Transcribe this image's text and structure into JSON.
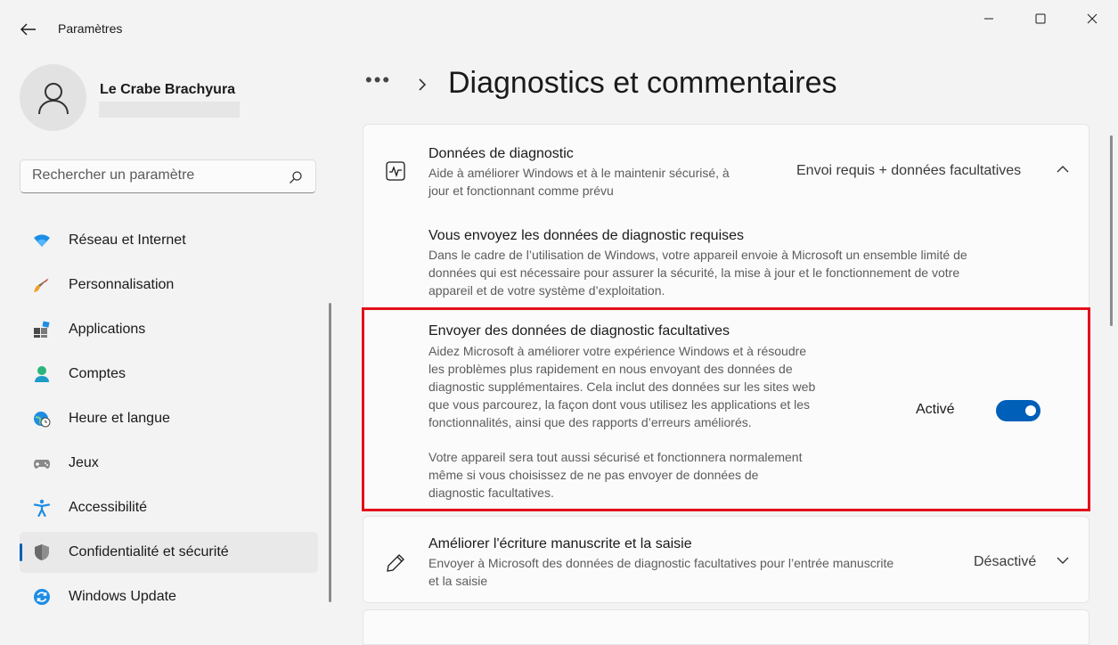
{
  "window": {
    "title": "Paramètres"
  },
  "profile": {
    "name": "Le Crabe Brachyura"
  },
  "search": {
    "placeholder": "Rechercher un paramètre"
  },
  "sidebar": {
    "items": [
      {
        "label": "Réseau et Internet",
        "icon": "wifi-icon"
      },
      {
        "label": "Personnalisation",
        "icon": "brush-icon"
      },
      {
        "label": "Applications",
        "icon": "apps-icon"
      },
      {
        "label": "Comptes",
        "icon": "person-icon"
      },
      {
        "label": "Heure et langue",
        "icon": "globe-clock-icon"
      },
      {
        "label": "Jeux",
        "icon": "gamepad-icon"
      },
      {
        "label": "Accessibilité",
        "icon": "accessibility-icon"
      },
      {
        "label": "Confidentialité et sécurité",
        "icon": "shield-icon",
        "selected": true
      },
      {
        "label": "Windows Update",
        "icon": "update-icon"
      }
    ]
  },
  "breadcrumb": {
    "more": "•••",
    "title": "Diagnostics et commentaires"
  },
  "diagnostic_data": {
    "title": "Données de diagnostic",
    "desc_line1": "Aide à améliorer Windows et à le maintenir sécurisé, à",
    "desc_line2": "jour et fonctionnant comme prévu",
    "value": "Envoi requis + données facultatives"
  },
  "required_data": {
    "title": "Vous envoyez les données de diagnostic requises",
    "desc_line1": "Dans le cadre de l’utilisation de Windows, votre appareil envoie à Microsoft un ensemble limité de",
    "desc_line2": "données qui est nécessaire pour assurer la sécurité, la mise à jour et le fonctionnement de votre",
    "desc_line3": "appareil et de votre système d’exploitation."
  },
  "optional_data": {
    "title": "Envoyer des données de diagnostic facultatives",
    "desc_line1": "Aidez Microsoft à améliorer votre expérience Windows et à résoudre",
    "desc_line2": "les problèmes plus rapidement en nous envoyant des données de",
    "desc_line3": "diagnostic supplémentaires. Cela inclut des données sur les sites web",
    "desc_line4": "que vous parcourez, la façon dont vous utilisez les applications et les",
    "desc_line5": "fonctionnalités, ainsi que des rapports d’erreurs améliorés.",
    "note_line1": "Votre appareil sera tout aussi sécurisé et fonctionnera normalement",
    "note_line2": "même si vous choisissez de ne pas envoyer de données de",
    "note_line3": "diagnostic facultatives.",
    "toggle_label": "Activé",
    "toggle_on": true
  },
  "inking": {
    "title": "Améliorer l'écriture manuscrite et la saisie",
    "desc_line1": "Envoyer à Microsoft des données de diagnostic facultatives pour l’entrée manuscrite",
    "desc_line2": "et la saisie",
    "value": "Désactivé"
  },
  "colors": {
    "accent": "#005fb8",
    "highlight": "#e3101b"
  }
}
